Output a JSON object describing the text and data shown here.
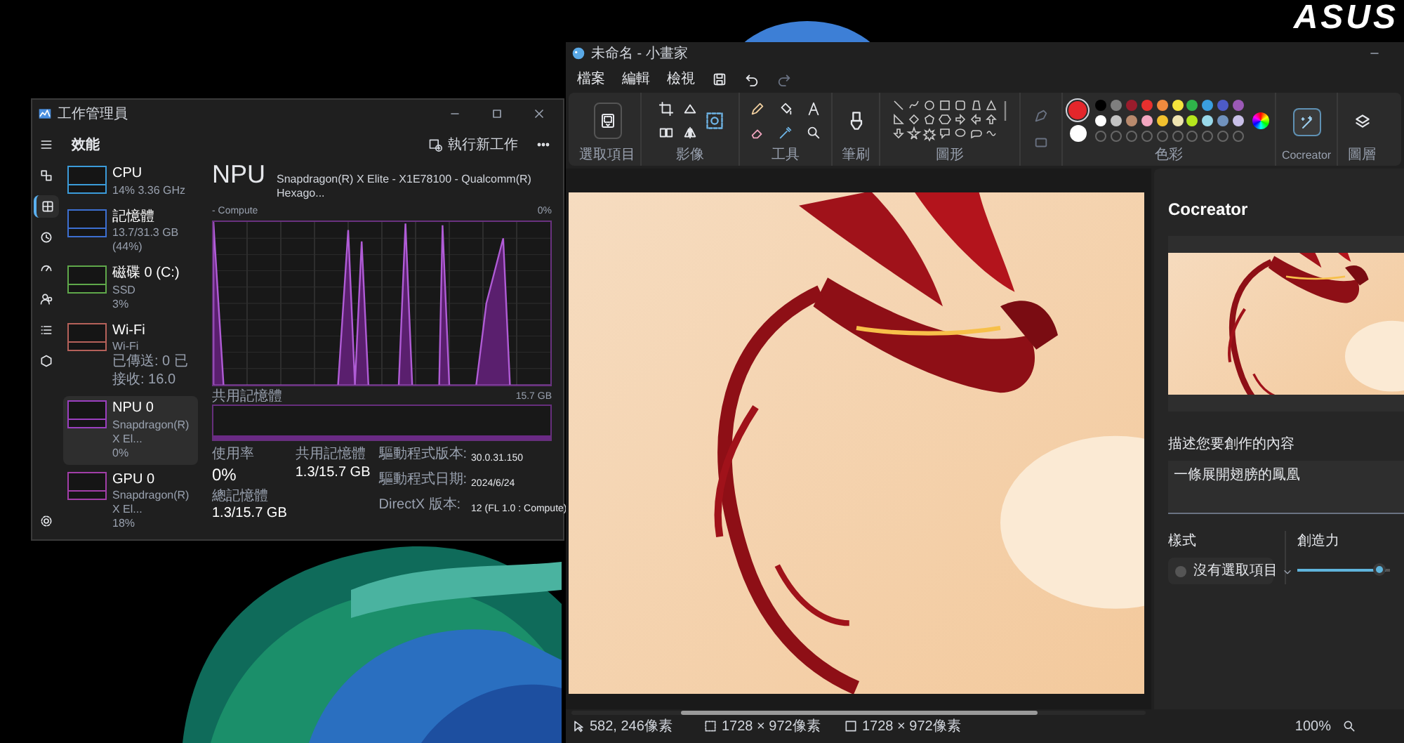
{
  "desktop": {
    "logo": "ASUS"
  },
  "task_manager": {
    "title": "工作管理員",
    "nav_items": [
      {
        "selected": false
      },
      {
        "selected": false
      },
      {
        "selected": true
      },
      {
        "selected": false
      },
      {
        "selected": false
      },
      {
        "selected": false
      },
      {
        "selected": false
      },
      {
        "selected": false
      }
    ],
    "section_title": "效能",
    "run_task_button": "執行新工作",
    "devices": [
      {
        "name": "CPU",
        "details": [
          "14% 3.36 GHz"
        ],
        "color": "#3b9bd9",
        "selected": false
      },
      {
        "name": "記憶體",
        "details": [
          "13.7/31.3 GB (44%)"
        ],
        "color": "#3c6fd1",
        "selected": false
      },
      {
        "name": "磁碟 0 (C:)",
        "details": [
          "SSD",
          "3%"
        ],
        "color": "#5fa84a",
        "selected": false
      },
      {
        "name": "Wi-Fi",
        "details": [
          "Wi-Fi",
          "已傳送: 0 已接收: 16.0"
        ],
        "color": "#b5615a",
        "selected": false
      },
      {
        "name": "NPU 0",
        "details": [
          "Snapdragon(R) X El...",
          "0%"
        ],
        "color": "#9b3fbf",
        "selected": true
      },
      {
        "name": "GPU 0",
        "details": [
          "Snapdragon(R) X El...",
          "18%"
        ],
        "color": "#a23ea8",
        "selected": false
      }
    ],
    "detail": {
      "device": "NPU",
      "model": "Snapdragon(R) X Elite - X1E78100 - Qualcomm(R) Hexago...",
      "graph_label": "- Compute",
      "graph_max": "0%",
      "shared_label": "共用記憶體",
      "shared_max": "15.7 GB",
      "stats": [
        {
          "label": "使用率",
          "value": "0%"
        },
        {
          "label": "共用記憶體",
          "value": "1.3/15.7 GB"
        },
        {
          "label": "總記憶體",
          "value": "1.3/15.7 GB"
        }
      ],
      "properties": [
        {
          "label": "驅動程式版本:",
          "value": "30.0.31.150"
        },
        {
          "label": "驅動程式日期:",
          "value": "2024/6/24"
        },
        {
          "label": "DirectX 版本:",
          "value": "12 (FL 1.0 : Compute)"
        }
      ]
    }
  },
  "paint": {
    "title": "未命名 - 小畫家",
    "menu": [
      "檔案",
      "編輯",
      "檢視"
    ],
    "ribbon_groups": [
      {
        "kind": "select",
        "label": "選取項目"
      },
      {
        "label": "影像"
      },
      {
        "kind": "tools",
        "label": "工具"
      },
      {
        "kind": "brushes",
        "label": "筆刷"
      },
      {
        "kind": "shapes",
        "label": "圖形"
      },
      {
        "kind": "extra"
      },
      {
        "kind": "colors",
        "label": "色彩"
      },
      {
        "kind": "cocreator",
        "label": "Cocreator",
        "selected": true
      },
      {
        "kind": "layers",
        "label": "圖層"
      }
    ],
    "current_colors": [
      {
        "color": "#e3262b",
        "selected": true
      },
      {
        "color": "#ffffff",
        "selected": false
      }
    ],
    "palette": [
      {
        "color": "#000000"
      },
      {
        "color": "#7f7f7f"
      },
      {
        "color": "#9b1c2c"
      },
      {
        "color": "#e8302e"
      },
      {
        "color": "#f08a3e"
      },
      {
        "color": "#f5e43c"
      },
      {
        "color": "#2fb34a"
      },
      {
        "color": "#3a9ee0"
      },
      {
        "color": "#4d5bc8"
      },
      {
        "color": "#9b59b6"
      },
      {
        "color": "#ffffff"
      },
      {
        "color": "#c3c3c3"
      },
      {
        "color": "#b98a6d"
      },
      {
        "color": "#f3a6c0"
      },
      {
        "color": "#f2c12e"
      },
      {
        "color": "#efe4b0"
      },
      {
        "color": "#b5e61d"
      },
      {
        "color": "#99d9ea"
      },
      {
        "color": "#7092be"
      },
      {
        "color": "#c8bfe7"
      }
    ],
    "custom_slots": [
      {
        "kind": "empty"
      },
      {
        "kind": "empty"
      },
      {
        "kind": "empty"
      },
      {
        "kind": "empty"
      },
      {
        "kind": "empty"
      },
      {
        "kind": "empty"
      },
      {
        "kind": "empty"
      },
      {
        "kind": "empty"
      },
      {
        "kind": "empty"
      },
      {
        "kind": "empty"
      }
    ],
    "cocreator": {
      "title": "Cocreator",
      "prompt_label": "描述您要創作的內容",
      "prompt": "一條展開翅膀的鳳凰",
      "style_label": "樣式",
      "style_value": "沒有選取項目",
      "creativity_label": "創造力",
      "creativity": {
        "level": 0.95
      }
    },
    "status_bar": {
      "cursor": "582, 246像素",
      "selection": "1728 × 972像素",
      "canvas": "1728 × 972像素",
      "zoom": "100%"
    }
  }
}
